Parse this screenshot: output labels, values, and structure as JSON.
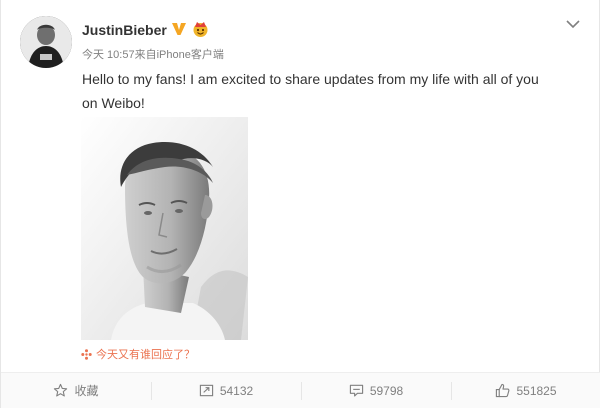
{
  "post": {
    "username": "JustinBieber",
    "time": "今天 10:57",
    "source_prefix": "来自",
    "source": "iPhone客户端",
    "text": "Hello to my fans! I am excited to share updates from my life with all of you on Weibo!",
    "interaction_prompt": "今天又有谁回应了？"
  },
  "icons": {
    "verified": "verified-v-icon",
    "badge": "emoji-badge-icon",
    "menu": "chevron-down-icon",
    "favorite": "star-icon",
    "repost": "repost-icon",
    "comment": "comment-icon",
    "like": "thumbs-up-icon"
  },
  "actions": {
    "favorite_label": "收藏",
    "repost_count": "54132",
    "comment_count": "59798",
    "like_count": "551825"
  },
  "colors": {
    "accent": "#eb7350",
    "verified": "#f5a623",
    "text": "#333333",
    "muted": "#808080"
  }
}
